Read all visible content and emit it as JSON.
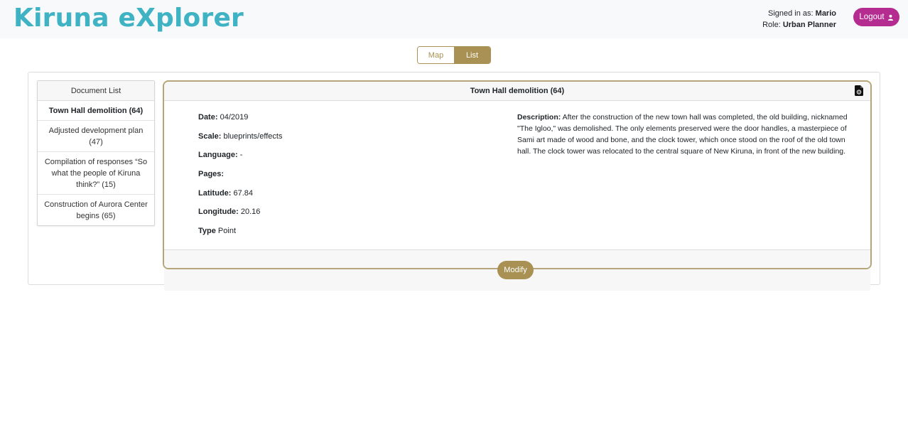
{
  "app": {
    "title": "Kiruna eXplorer"
  },
  "user": {
    "signed_in_label": "Signed in as:",
    "name": "Mario",
    "role_label": "Role:",
    "role": "Urban Planner",
    "logout_label": "Logout"
  },
  "view_toggle": {
    "map_label": "Map",
    "list_label": "List",
    "active": "List"
  },
  "document_list": {
    "header": "Document List",
    "items": [
      {
        "label": "Town Hall demolition (64)",
        "active": true
      },
      {
        "label": "Adjusted development plan (47)",
        "active": false
      },
      {
        "label": "Compilation of responses “So what the people of Kiruna think?” (15)",
        "active": false
      },
      {
        "label": "Construction of Aurora Center begins (65)",
        "active": false
      }
    ]
  },
  "detail": {
    "title": "Town Hall demolition (64)",
    "date_label": "Date:",
    "date": "04/2019",
    "scale_label": "Scale:",
    "scale": "blueprints/effects",
    "language_label": "Language:",
    "language": "-",
    "pages_label": "Pages:",
    "pages": "",
    "latitude_label": "Latitude:",
    "latitude": "67.84",
    "longitude_label": "Longitude:",
    "longitude": "20.16",
    "type_label": "Type",
    "type": "Point",
    "description_label": "Description:",
    "description": "After the construction of the new town hall was completed, the old building, nicknamed \"The Igloo,\" was demolished. The only elements preserved were the door handles, a masterpiece of Sami art made of wood and bone, and the clock tower, which once stood on the roof of the old town hall. The clock tower was relocated to the central square of New Kiruna, in front of the new building.",
    "modify_label": "Modify"
  },
  "colors": {
    "brand": "#3fb3c4",
    "accent_gold": "#a89152",
    "logout_magenta": "#b52c91"
  }
}
